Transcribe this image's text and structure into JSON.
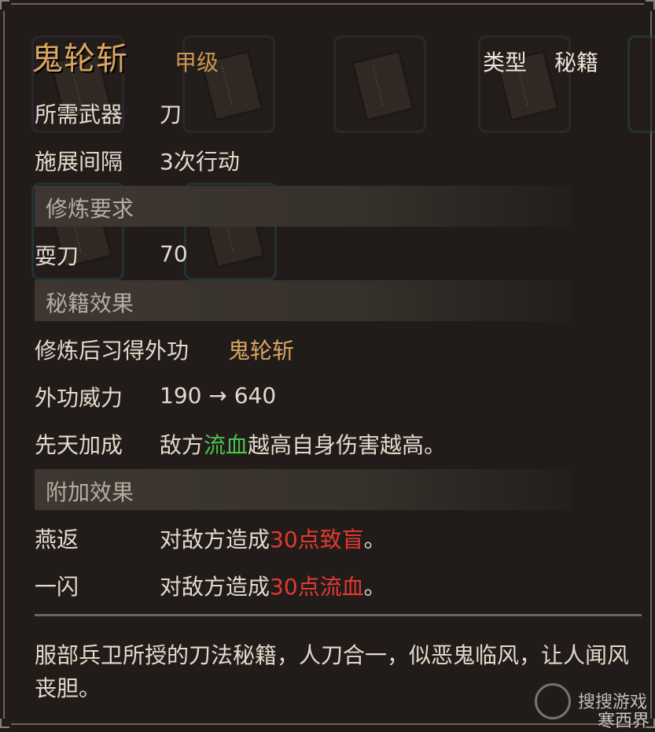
{
  "item": {
    "name": "鬼轮斩",
    "grade": "甲级",
    "type_label": "类型",
    "type_value": "秘籍"
  },
  "stats": [
    {
      "label": "所需武器",
      "value": "刀"
    },
    {
      "label": "施展间隔",
      "value": "3次行动"
    }
  ],
  "requirements": {
    "header": "修炼要求",
    "rows": [
      {
        "label": "耍刀",
        "value": "70"
      }
    ]
  },
  "effects": {
    "header": "秘籍效果",
    "learn_label": "修炼后习得外功",
    "learn_value": "鬼轮斩",
    "power_label": "外功威力",
    "power_value": "190 → 640",
    "innate_label": "先天加成",
    "innate_pre": "敌方",
    "innate_highlight": "流血",
    "innate_post": "越高自身伤害越高。"
  },
  "extra": {
    "header": "附加效果",
    "rows": [
      {
        "label": "燕返",
        "pre": "对敌方造成",
        "highlight": "30点致盲",
        "post": "。"
      },
      {
        "label": "一闪",
        "pre": "对敌方造成",
        "highlight": "30点流血",
        "post": "。"
      }
    ]
  },
  "description": "服部兵卫所授的刀法秘籍，人刀合一，似恶鬼临风，让人闻风丧胆。",
  "watermark": {
    "site": "搜搜游戏",
    "author": "寒西界"
  },
  "colors": {
    "title": "#d9a562",
    "green": "#4cc24c",
    "red": "#e03a32"
  }
}
